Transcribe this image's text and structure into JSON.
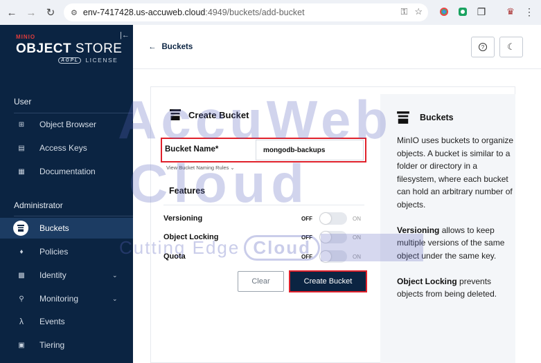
{
  "browser": {
    "url_host": "env-7417428.us-accuweb.cloud",
    "url_path": ":4949/buckets/add-bucket"
  },
  "sidebar": {
    "logo_small": "MINIO",
    "logo_object": "OBJECT",
    "logo_store": " STORE",
    "logo_agpl": "AGPL",
    "logo_license": "LICENSE",
    "user_section": "User",
    "user_items": [
      {
        "label": "Object Browser",
        "icon": "object-browser-icon"
      },
      {
        "label": "Access Keys",
        "icon": "access-keys-icon"
      },
      {
        "label": "Documentation",
        "icon": "documentation-icon"
      }
    ],
    "admin_section": "Administrator",
    "admin_items": [
      {
        "label": "Buckets",
        "icon": "buckets-icon"
      },
      {
        "label": "Policies",
        "icon": "policies-icon"
      },
      {
        "label": "Identity",
        "icon": "identity-icon"
      },
      {
        "label": "Monitoring",
        "icon": "monitoring-icon"
      },
      {
        "label": "Events",
        "icon": "events-icon"
      },
      {
        "label": "Tiering",
        "icon": "tiering-icon"
      }
    ]
  },
  "header": {
    "back_label": "Buckets"
  },
  "form": {
    "title": "Create Bucket",
    "bucket_name_label": "Bucket Name*",
    "bucket_name_value": "mongodb-backups",
    "naming_rules": "View Bucket Naming Rules",
    "features_title": "Features",
    "toggles": [
      {
        "label": "Versioning",
        "off": "OFF",
        "on": "ON"
      },
      {
        "label": "Object Locking",
        "off": "OFF",
        "on": "ON"
      },
      {
        "label": "Quota",
        "off": "OFF",
        "on": "ON"
      }
    ],
    "clear_label": "Clear",
    "create_label": "Create Bucket"
  },
  "help": {
    "title": "Buckets",
    "p1": "MinIO uses buckets to organize objects. A bucket is similar to a folder or directory in a filesystem, where each bucket can hold an arbitrary number of objects.",
    "versioning_bold": "Versioning",
    "versioning_rest": " allows to keep multiple versions of the same object under the same key.",
    "locking_bold": "Object Locking",
    "locking_rest": " prevents objects from being deleted."
  },
  "watermark": {
    "line1": "AccuWeb",
    "line2": "Cloud",
    "line3a": "Cutting Edge",
    "line3b": "Cloud"
  },
  "colors": {
    "sidebar_bg": "#0b2442",
    "accent_red": "#e0202a",
    "primary_button": "#0b2442"
  }
}
